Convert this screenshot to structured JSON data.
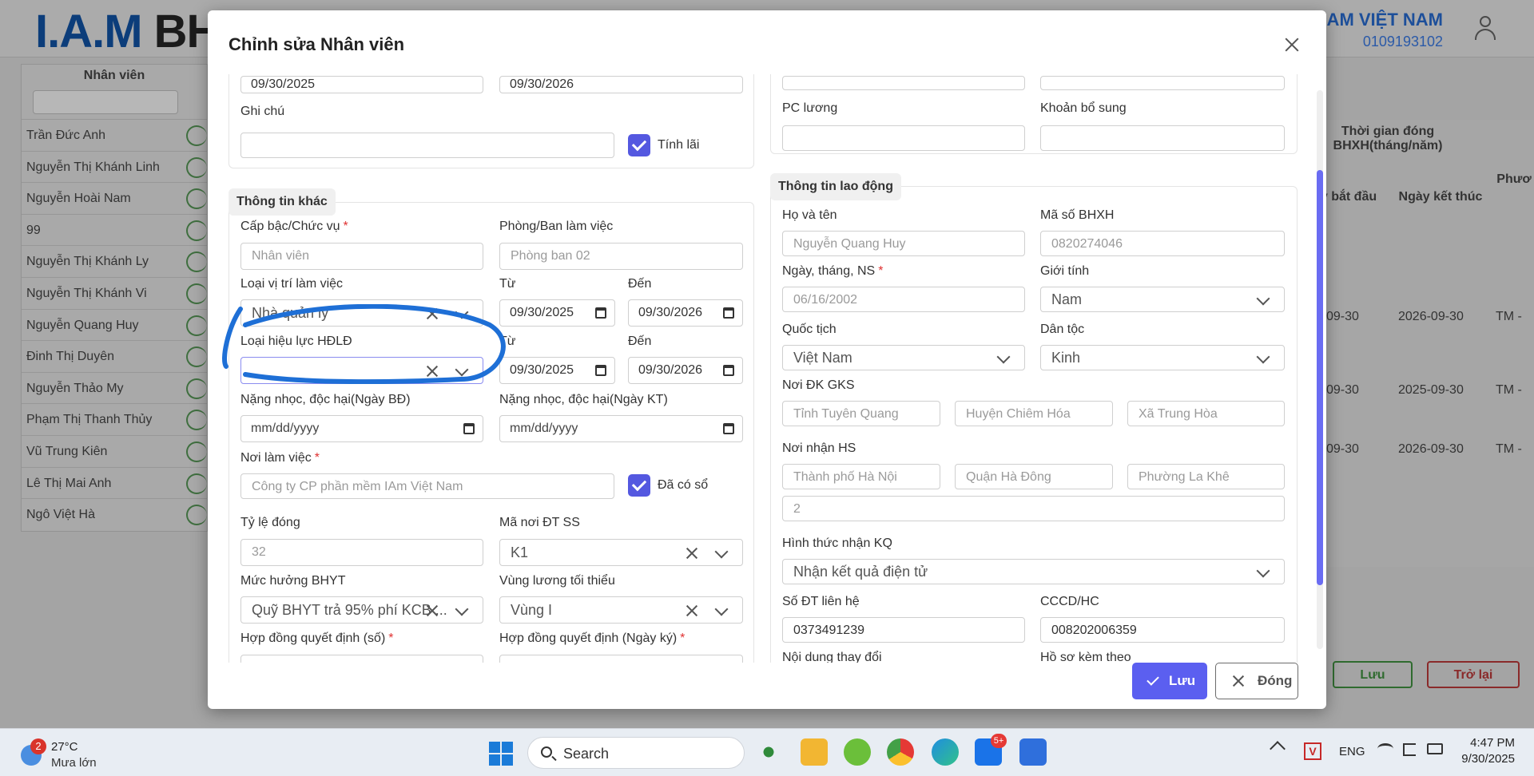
{
  "background": {
    "company_name": "IAM VIỆT NAM",
    "company_tax": "0109193102",
    "employee_header": "Nhân viên",
    "employees": [
      "Trần Đức Anh",
      "Nguyễn Thị Khánh Linh",
      "Nguyễn Hoài Nam",
      "99",
      "Nguyễn Thị Khánh Ly",
      "Nguyễn Thị Khánh Vi",
      "Nguyễn Quang Huy",
      "Đinh Thị Duyên",
      "Nguyễn Thảo My",
      "Phạm Thị Thanh Thủy",
      "Vũ Trung Kiên",
      "Lê Thị Mai Anh",
      "Ngô Việt Hà"
    ],
    "table_header_period": "Thời gian đóng BHXH(tháng/năm)",
    "table_header_start": "y bắt đầu",
    "table_header_end": "Ngày kết thúc",
    "table_header_extra": "Phươ",
    "rows": [
      {
        "start": "09-30",
        "end": "2026-09-30",
        "extra": "TM -"
      },
      {
        "start": "09-30",
        "end": "2025-09-30",
        "extra": "TM -"
      },
      {
        "start": "09-30",
        "end": "2026-09-30",
        "extra": "TM -"
      }
    ],
    "save_label": "Lưu",
    "back_label": "Trở lại"
  },
  "modal": {
    "title": "Chỉnh sửa Nhân viên",
    "save_label": "Lưu",
    "close_label": "Đóng",
    "left": {
      "top_date_from": "09/30/2025",
      "top_date_to": "09/30/2026",
      "note_label": "Ghi chú",
      "note_value": "",
      "interest_label": "Tính lãi",
      "other_section": "Thông tin khác",
      "rank_label": "Cấp bậc/Chức vụ",
      "rank_value": "Nhân viên",
      "dept_label": "Phòng/Ban làm việc",
      "dept_value": "Phòng ban 02",
      "position_type_label": "Loại vị trí làm việc",
      "position_type_value": "Nhà quản lý",
      "from_label": "Từ",
      "to_label": "Đến",
      "position_from": "09/30/2025",
      "position_to": "09/30/2026",
      "contract_type_label": "Loại hiệu lực HĐLĐ",
      "contract_type_value": "",
      "contract_from": "09/30/2025",
      "contract_to": "09/30/2026",
      "hazard_start_label": "Nặng nhọc, độc hại(Ngày BĐ)",
      "hazard_end_label": "Nặng nhọc, độc hại(Ngày KT)",
      "date_placeholder": "mm/dd/yyyy",
      "workplace_label": "Nơi làm việc",
      "workplace_value": "Công ty CP phần mềm IAm Việt Nam",
      "has_book_label": "Đã có sổ",
      "rate_label": "Tỷ lệ đóng",
      "rate_value": "32",
      "ss_code_label": "Mã nơi ĐT SS",
      "ss_code_value": "K1",
      "bhyt_label": "Mức hưởng BHYT",
      "bhyt_value": "Quỹ BHYT trả 95% phí KCB ...",
      "min_wage_label": "Vùng lương tối thiểu",
      "min_wage_value": "Vùng I",
      "contract_no_label": "Hợp đồng quyết định (số)",
      "contract_date_label": "Hợp đồng quyết định (Ngày ký)"
    },
    "right": {
      "salary_allow_label": "PC lương",
      "extra_label": "Khoản bổ sung",
      "labor_section": "Thông tin lao động",
      "fullname_label": "Họ và tên",
      "fullname_value": "Nguyễn Quang Huy",
      "bhxh_label": "Mã số BHXH",
      "bhxh_value": "0820274046",
      "dob_label": "Ngày, tháng, NS",
      "dob_value": "06/16/2002",
      "gender_label": "Giới tính",
      "gender_value": "Nam",
      "nationality_label": "Quốc tịch",
      "nationality_value": "Việt Nam",
      "ethnic_label": "Dân tộc",
      "ethnic_value": "Kinh",
      "birth_reg_label": "Nơi ĐK GKS",
      "birth_province": "Tỉnh Tuyên Quang",
      "birth_district": "Huyện Chiêm Hóa",
      "birth_commune": "Xã Trung Hòa",
      "receive_label": "Nơi nhận HS",
      "recv_city": "Thành phố Hà Nội",
      "recv_district": "Quận Hà Đông",
      "recv_ward": "Phường La Khê",
      "recv_address": "2",
      "result_label": "Hình thức nhận KQ",
      "result_value": "Nhận kết quả điện tử",
      "phone_label": "Số ĐT liên hệ",
      "phone_value": "0373491239",
      "id_label": "CCCD/HC",
      "id_value": "008202006359",
      "change_label": "Nội dung thay đổi",
      "attach_label": "Hồ sơ kèm theo"
    }
  },
  "taskbar": {
    "temp": "27°C",
    "weather": "Mưa lớn",
    "weather_badge": "2",
    "search": "Search",
    "lang": "ENG",
    "time": "4:47 PM",
    "date": "9/30/2025",
    "zalo_badge": "5+"
  },
  "colors": {
    "accent": "#5b5ff0",
    "annotation": "#1e6fd6",
    "required": "#e03131"
  }
}
